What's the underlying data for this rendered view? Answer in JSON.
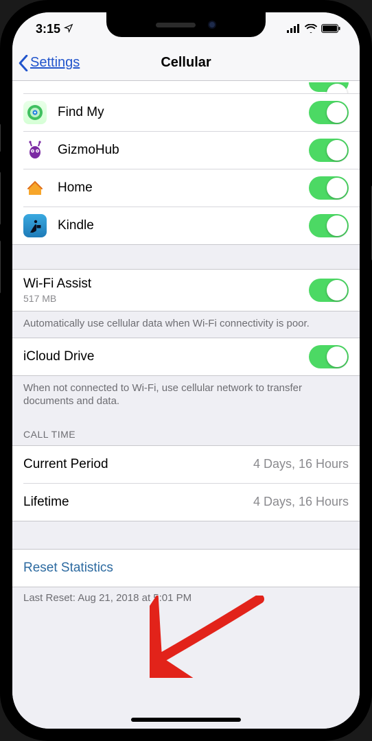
{
  "status": {
    "time": "3:15"
  },
  "nav": {
    "back": "Settings",
    "title": "Cellular"
  },
  "apps": {
    "find_my": "Find My",
    "gizmohub": "GizmoHub",
    "home": "Home",
    "kindle": "Kindle"
  },
  "wifi_assist": {
    "title": "Wi-Fi Assist",
    "usage": "517 MB",
    "footer": "Automatically use cellular data when Wi-Fi connectivity is poor."
  },
  "icloud": {
    "title": "iCloud Drive",
    "footer": "When not connected to Wi-Fi, use cellular network to transfer documents and data."
  },
  "call_time": {
    "header": "CALL TIME",
    "current_label": "Current Period",
    "current_value": "4 Days, 16 Hours",
    "lifetime_label": "Lifetime",
    "lifetime_value": "4 Days, 16 Hours"
  },
  "reset": {
    "label": "Reset Statistics",
    "footer": "Last Reset: Aug 21, 2018 at 5:01 PM"
  }
}
